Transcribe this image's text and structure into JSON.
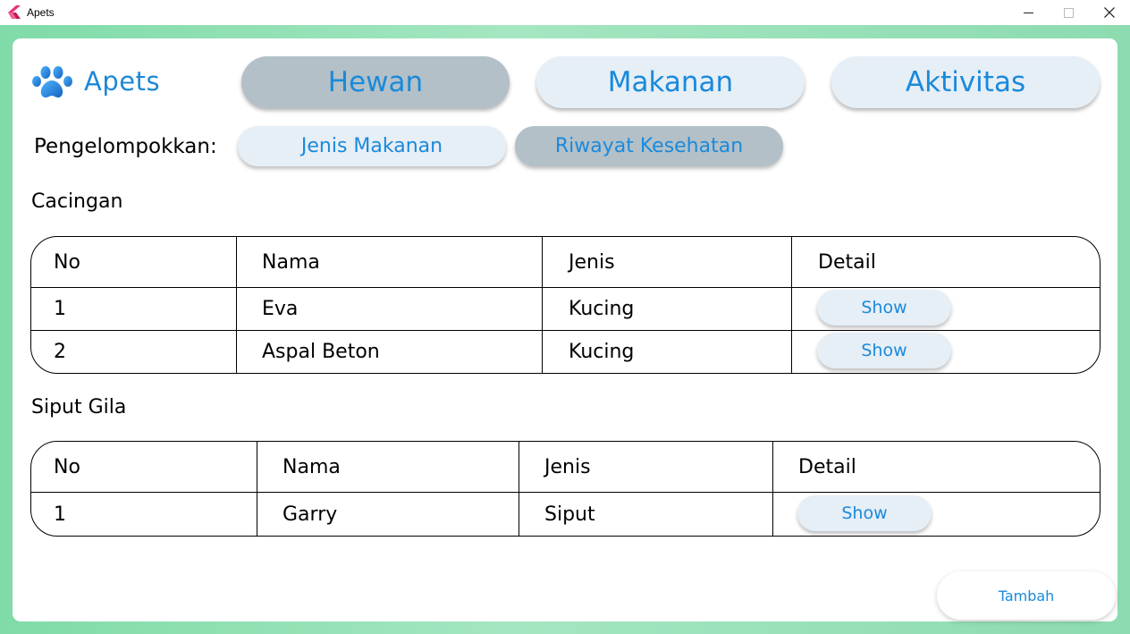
{
  "window": {
    "title": "Apets"
  },
  "brand": {
    "name": "Apets",
    "accent": "#1e88d6"
  },
  "nav": [
    {
      "label": "Hewan",
      "active": true
    },
    {
      "label": "Makanan",
      "active": false
    },
    {
      "label": "Aktivitas",
      "active": false
    }
  ],
  "grouping": {
    "label": "Pengelompokkan:",
    "options": [
      {
        "label": "Jenis Makanan",
        "active": false
      },
      {
        "label": "Riwayat Kesehatan",
        "active": true
      }
    ]
  },
  "sections": [
    {
      "title": "Cacingan",
      "headers": [
        "No",
        "Nama",
        "Jenis",
        "Detail"
      ],
      "rows": [
        {
          "no": "1",
          "nama": "Eva",
          "jenis": "Kucing",
          "detail": "Show"
        },
        {
          "no": "2",
          "nama": "Aspal Beton",
          "jenis": "Kucing",
          "detail": "Show"
        }
      ]
    },
    {
      "title": "Siput Gila",
      "headers": [
        "No",
        "Nama",
        "Jenis",
        "Detail"
      ],
      "rows": [
        {
          "no": "1",
          "nama": "Garry",
          "jenis": "Siput",
          "detail": "Show"
        }
      ]
    }
  ],
  "actions": {
    "add_label": "Tambah"
  },
  "icons": {
    "app": "app-flutter-icon",
    "logo": "paw-icon",
    "minimize": "minimize-icon",
    "maximize": "maximize-icon",
    "close": "close-icon"
  }
}
